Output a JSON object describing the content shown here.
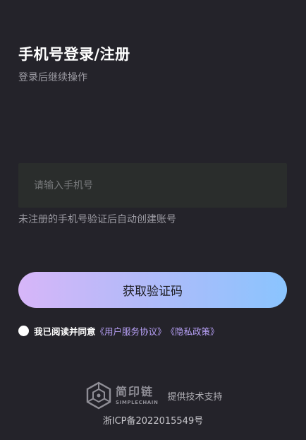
{
  "header": {
    "title": "手机号登录/注册",
    "subtitle": "登录后继续操作"
  },
  "phone": {
    "placeholder": "请输入手机号",
    "value": "",
    "hint": "未注册的手机号验证后自动创建账号"
  },
  "actions": {
    "get_code_label": "获取验证码"
  },
  "agreement": {
    "text": "我已阅读并同意",
    "user_agreement": "《用户服务协议》",
    "privacy_policy": "《隐私政策》"
  },
  "footer": {
    "brand_cn": "简印链",
    "brand_en": "SIMPLECHAIN",
    "support_text": "提供技术支持",
    "icp": "浙ICP备2022015549号"
  },
  "colors": {
    "background": "#24232a",
    "input_bg": "#2a2d2c",
    "link": "#b7a0f6",
    "button_gradient_start": "#d7b6f9",
    "button_gradient_end": "#8ac4fe"
  }
}
